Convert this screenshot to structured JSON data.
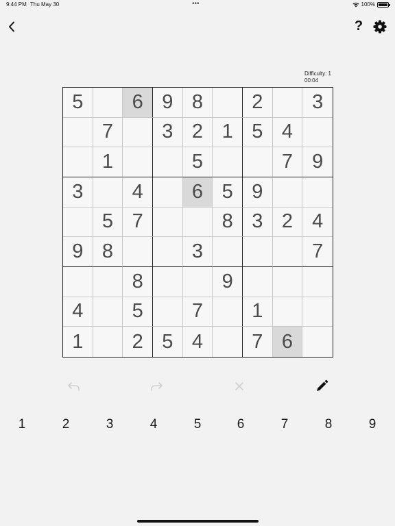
{
  "status_bar": {
    "time": "9:44 PM",
    "date": "Thu May 30",
    "dots": "•••",
    "battery": "100%"
  },
  "nav": {
    "back_icon": "chevron-left-icon",
    "help_label": "?",
    "settings_icon": "gear-icon"
  },
  "info": {
    "difficulty": "Difficulty: 1",
    "timer": "00:04"
  },
  "board": {
    "rows": [
      [
        "5",
        "",
        "6",
        "9",
        "8",
        "",
        "2",
        "",
        "3"
      ],
      [
        "",
        "7",
        "",
        "3",
        "2",
        "1",
        "5",
        "4",
        ""
      ],
      [
        "",
        "1",
        "",
        "",
        "5",
        "",
        "",
        "7",
        "9"
      ],
      [
        "3",
        "",
        "4",
        "",
        "6",
        "5",
        "9",
        "",
        ""
      ],
      [
        "",
        "5",
        "7",
        "",
        "",
        "8",
        "3",
        "2",
        "4"
      ],
      [
        "9",
        "8",
        "",
        "",
        "3",
        "",
        "",
        "",
        "7"
      ],
      [
        "",
        "",
        "8",
        "",
        "",
        "9",
        "",
        "",
        ""
      ],
      [
        "4",
        "",
        "5",
        "",
        "7",
        "",
        "1",
        "",
        ""
      ],
      [
        "1",
        "",
        "2",
        "5",
        "4",
        "",
        "7",
        "6",
        ""
      ]
    ],
    "highlighted_cells": [
      [
        0,
        2
      ],
      [
        3,
        4
      ],
      [
        8,
        7
      ]
    ],
    "highlight_color": "#d9d9d9"
  },
  "toolbar": {
    "undo_icon": "undo-icon",
    "redo_icon": "redo-icon",
    "erase_icon": "erase-icon",
    "pencil_icon": "pencil-icon"
  },
  "numpad": [
    "1",
    "2",
    "3",
    "4",
    "5",
    "6",
    "7",
    "8",
    "9"
  ]
}
